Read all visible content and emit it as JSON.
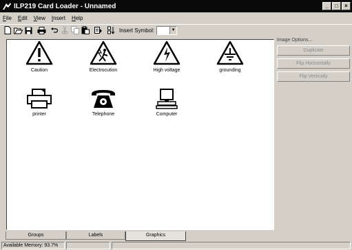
{
  "window": {
    "title": "ILP219 Card Loader - Unnamed",
    "buttons": [
      "_",
      "□",
      "×"
    ]
  },
  "menu": [
    "File",
    "Edit",
    "View",
    "Insert",
    "Help"
  ],
  "toolbar": {
    "insert_symbol_label": "Insert Symbol:",
    "insert_symbol_value": "",
    "icons": [
      "new-icon",
      "open-icon",
      "save-icon",
      "print-icon",
      "undo-icon",
      "cut-icon",
      "copy-icon",
      "paste-icon",
      "paste-special-icon",
      "arrange-icon"
    ]
  },
  "symbols": [
    {
      "label": "Caution",
      "icon": "caution-icon"
    },
    {
      "label": "Electrocution",
      "icon": "electrocution-icon"
    },
    {
      "label": "High voltage",
      "icon": "high-voltage-icon"
    },
    {
      "label": "grounding",
      "icon": "grounding-icon"
    },
    {
      "label": "printer",
      "icon": "printer-icon"
    },
    {
      "label": "Telephone",
      "icon": "telephone-icon"
    },
    {
      "label": "Computer",
      "icon": "computer-icon"
    }
  ],
  "image_options": {
    "title": "Image Options...",
    "buttons": [
      "Duplicate",
      "Flip Horizontally",
      "Flip Vertically"
    ]
  },
  "tabs": [
    {
      "label": "Groups",
      "active": false
    },
    {
      "label": "Labels",
      "active": false
    },
    {
      "label": "Graphics",
      "active": true
    }
  ],
  "status": {
    "memory": "Available Memory: 93.7%"
  }
}
